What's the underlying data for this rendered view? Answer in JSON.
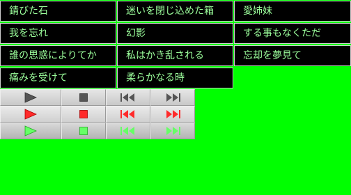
{
  "colors": {
    "background": "#00ff00",
    "cell_bg": "#000000",
    "cell_text": "#9cff9c",
    "icon_normal": "#555555",
    "icon_hover": "#ff2a2a",
    "icon_active": "#66ff66"
  },
  "tracks": [
    [
      "錆びた石",
      "迷いを閉じ込めた箱",
      "愛姉妹"
    ],
    [
      "我を忘れ",
      "幻影",
      "する事もなくただ"
    ],
    [
      "誰の思惑によりてか",
      "私はかき乱される",
      "忘却を夢見て"
    ],
    [
      "痛みを受けて",
      "柔らかなる時"
    ]
  ],
  "controls": {
    "buttons": [
      "play-icon",
      "stop-icon",
      "previous-icon",
      "next-icon"
    ],
    "states": [
      "normal",
      "hover",
      "active"
    ]
  }
}
